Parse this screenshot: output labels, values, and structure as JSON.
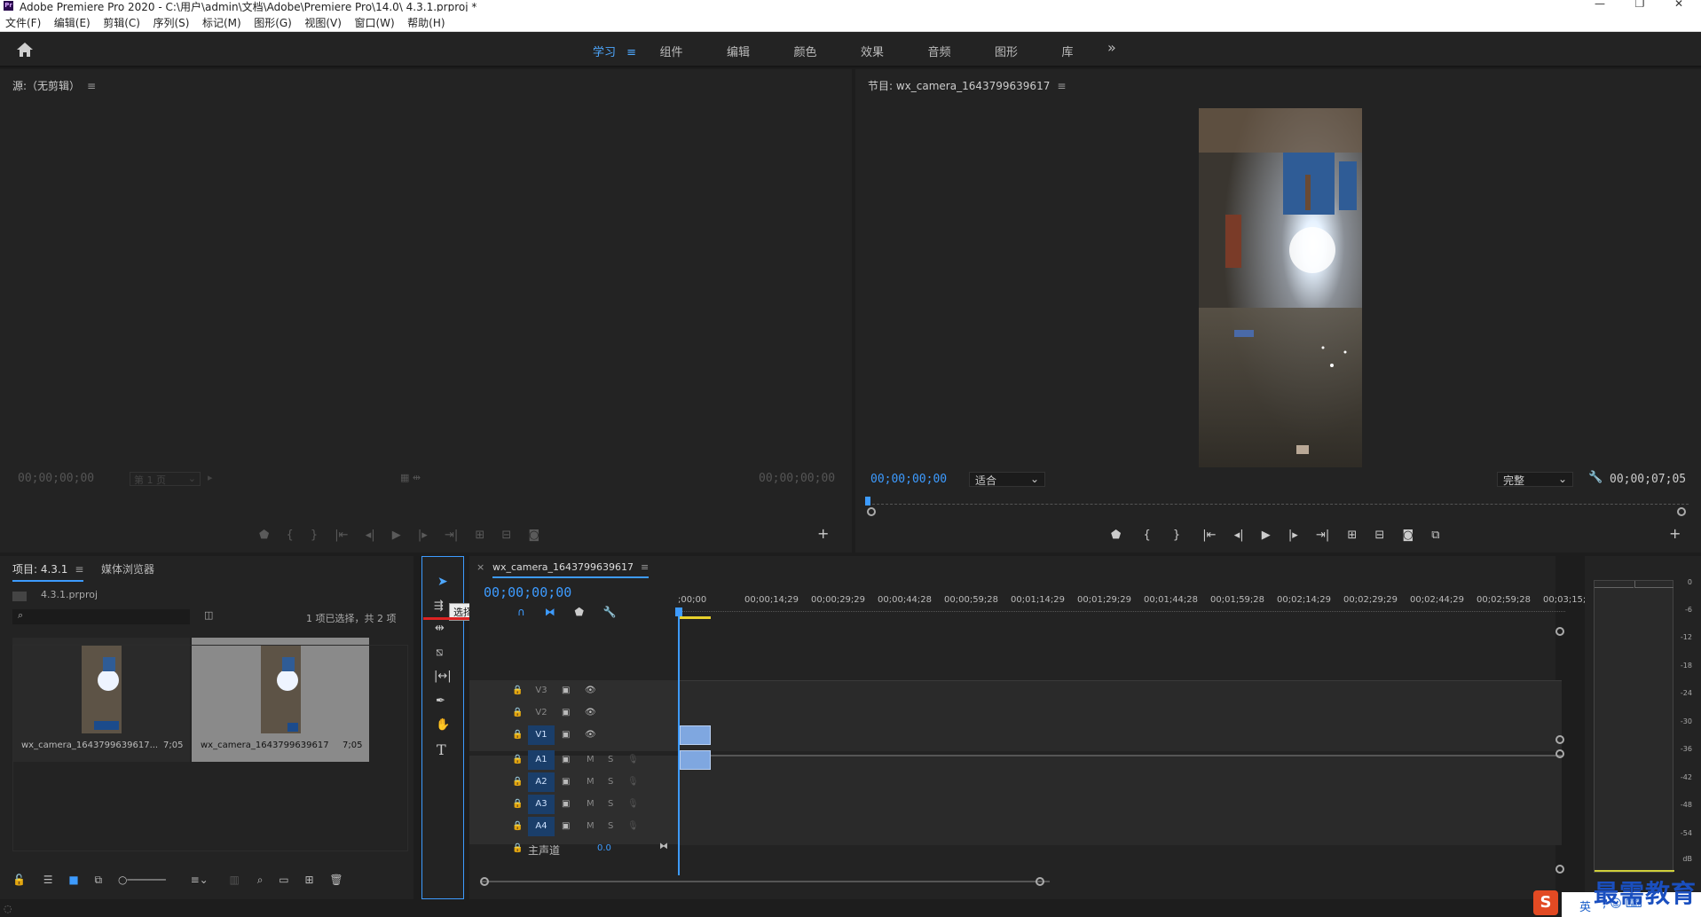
{
  "app": {
    "title": "Adobe Premiere Pro 2020 - C:\\用户\\admin\\文档\\Adobe\\Premiere Pro\\14.0\\ 4.3.1.prproj *",
    "logo": "Pr",
    "window_controls": [
      "—",
      "❐",
      "✕"
    ]
  },
  "menu": [
    "文件(F)",
    "编辑(E)",
    "剪辑(C)",
    "序列(S)",
    "标记(M)",
    "图形(G)",
    "视图(V)",
    "窗口(W)",
    "帮助(H)"
  ],
  "workspace": {
    "tabs": [
      "学习",
      "组件",
      "编辑",
      "颜色",
      "效果",
      "音频",
      "图形",
      "库"
    ],
    "active_index": 0,
    "more": "»"
  },
  "source": {
    "title": "源:（无剪辑）",
    "timecode_left": "00;00;00;00",
    "page_select": "第 1 页",
    "timecode_right": "00;00;00;00"
  },
  "program": {
    "title": "节目: wx_camera_1643799639617",
    "timecode": "00;00;00;00",
    "zoom": "适合",
    "quality": "完整",
    "duration": "00;00;07;05"
  },
  "project": {
    "tab_label": "项目: 4.3.1",
    "media_browser": "媒体浏览器",
    "project_file": "4.3.1.prproj",
    "selection_info": "1 项已选择，共 2 项",
    "items": [
      {
        "name": "wx_camera_1643799639617...",
        "duration": "7;05",
        "selected": false
      },
      {
        "name": "wx_camera_1643799639617",
        "duration": "7;05",
        "selected": true
      }
    ]
  },
  "tools": {
    "tooltip": "选择工具 (V)",
    "items": [
      "selection-tool",
      "track-select-tool",
      "ripple-edit-tool",
      "razor-tool",
      "slip-tool",
      "pen-tool",
      "hand-tool",
      "type-tool"
    ]
  },
  "timeline": {
    "sequence_name": "wx_camera_1643799639617",
    "timecode": "00;00;00;00",
    "ruler": [
      ";00;00",
      "00;00;14;29",
      "00;00;29;29",
      "00;00;44;28",
      "00;00;59;28",
      "00;01;14;29",
      "00;01;29;29",
      "00;01;44;28",
      "00;01;59;28",
      "00;02;14;29",
      "00;02;29;29",
      "00;02;44;29",
      "00;02;59;28",
      "00;03;15;"
    ],
    "video_tracks": [
      "V3",
      "V2",
      "V1"
    ],
    "audio_tracks": [
      "A1",
      "A2",
      "A3",
      "A4"
    ],
    "master_label": "主声道",
    "master_value": "0.0",
    "mute_label": "M",
    "solo_label": "S"
  },
  "meter": {
    "ticks": [
      "0",
      "-6",
      "-12",
      "-18",
      "-24",
      "-30",
      "-36",
      "-42",
      "-48",
      "-54",
      "dB"
    ]
  },
  "watermark": {
    "text": "最需教育",
    "ime_label": "英"
  },
  "colors": {
    "accent": "#3d9bff",
    "panel_bg": "#232323",
    "track_badge": "#1a3e6a",
    "clip": "#7fa7e0",
    "annotation": "#d22"
  }
}
